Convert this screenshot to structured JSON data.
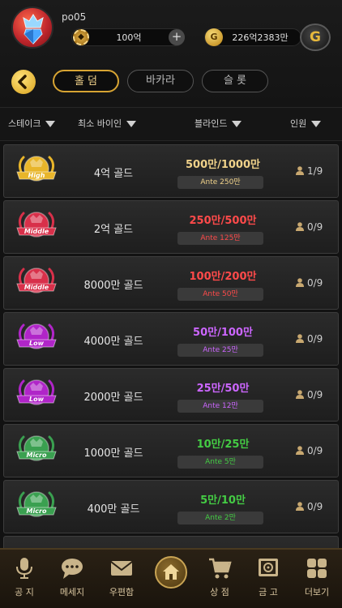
{
  "header": {
    "username": "po05",
    "chips_value": "100억",
    "gold_value": "226억2383만",
    "plus_label": "+",
    "gold_coin_letter": "G",
    "g_button_letter": "G"
  },
  "tabs": [
    {
      "label": "홀 덤",
      "active": true
    },
    {
      "label": "바카라",
      "active": false
    },
    {
      "label": "슬 롯",
      "active": false
    }
  ],
  "columns": [
    "스테이크",
    "최소 바이인",
    "블라인드",
    "인원"
  ],
  "rows": [
    {
      "tier": "High",
      "stake": "4억 골드",
      "blinds": "500만/1000만",
      "ante": "Ante 250만",
      "players": "1/9",
      "blind_color": "#f0d28a"
    },
    {
      "tier": "Middle",
      "stake": "2억 골드",
      "blinds": "250만/500만",
      "ante": "Ante 125만",
      "players": "0/9",
      "blind_color": "#ff4a4a"
    },
    {
      "tier": "Middle",
      "stake": "8000만 골드",
      "blinds": "100만/200만",
      "ante": "Ante 50만",
      "players": "0/9",
      "blind_color": "#ff4a4a"
    },
    {
      "tier": "Low",
      "stake": "4000만 골드",
      "blinds": "50만/100만",
      "ante": "Ante 25만",
      "players": "0/9",
      "blind_color": "#cc66ff"
    },
    {
      "tier": "Low",
      "stake": "2000만 골드",
      "blinds": "25만/50만",
      "ante": "Ante 12만",
      "players": "0/9",
      "blind_color": "#cc66ff"
    },
    {
      "tier": "Micro",
      "stake": "1000만 골드",
      "blinds": "10만/25만",
      "ante": "Ante 5만",
      "players": "0/9",
      "blind_color": "#44cc44"
    },
    {
      "tier": "Micro",
      "stake": "400만 골드",
      "blinds": "5만/10만",
      "ante": "Ante 2만",
      "players": "0/9",
      "blind_color": "#44cc44"
    }
  ],
  "nav": [
    {
      "label": "공 지",
      "icon": "microphone-icon"
    },
    {
      "label": "메세지",
      "icon": "chat-icon"
    },
    {
      "label": "우편함",
      "icon": "mail-icon"
    },
    {
      "label": "",
      "icon": "home-icon"
    },
    {
      "label": "상 점",
      "icon": "cart-icon"
    },
    {
      "label": "금 고",
      "icon": "safe-icon"
    },
    {
      "label": "더보기",
      "icon": "grid-icon"
    }
  ],
  "colors": {
    "accent_gold": "#d7a433",
    "high": "#e8b52a",
    "middle": "#d8304a",
    "low": "#b025c8",
    "micro": "#3aa050"
  }
}
